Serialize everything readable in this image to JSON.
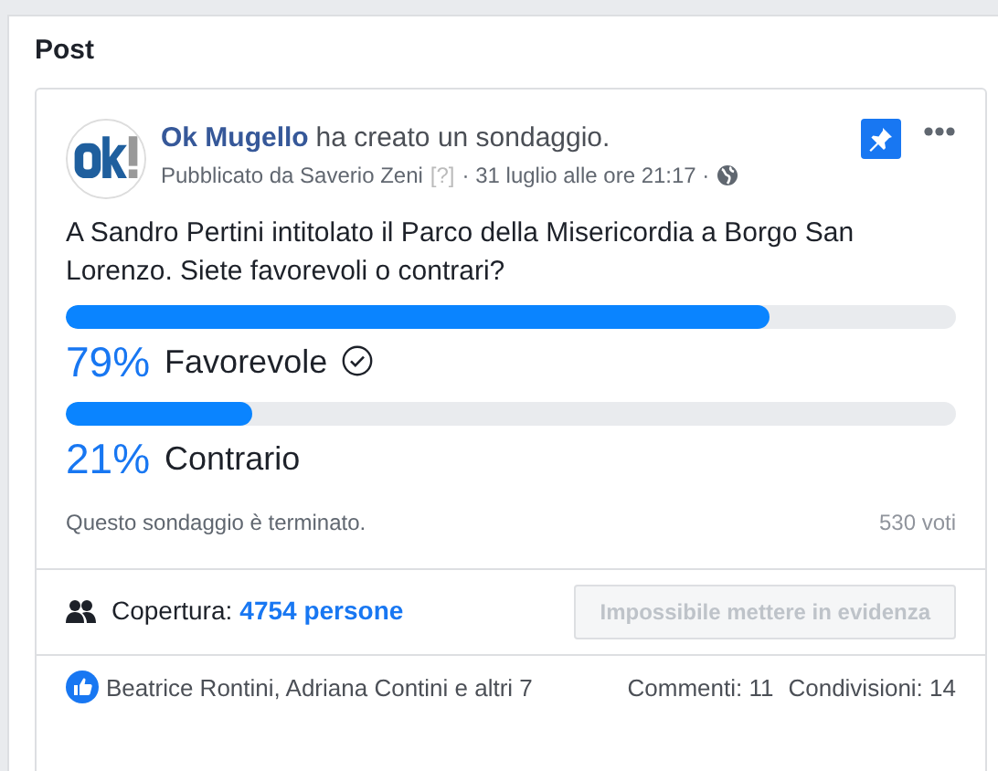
{
  "section_title": "Post",
  "post": {
    "page_name": "Ok Mugello",
    "action": "ha creato un sondaggio.",
    "byline": "Pubblicato da Saverio Zeni",
    "help_mark": "[?]",
    "date": "· 31 luglio alle ore 21:17 ·",
    "pinned": true,
    "text": "A Sandro Pertini intitolato il Parco della Misericordia a Borgo San Lorenzo. Siete favorevoli o contrari?"
  },
  "poll": {
    "options": [
      {
        "percent": "79%",
        "label": "Favorevole",
        "level": 0.79,
        "selected": true
      },
      {
        "percent": "21%",
        "label": "Contrario",
        "level": 0.21,
        "selected": false
      }
    ],
    "status": "Questo sondaggio è terminato.",
    "votes": "530 voti"
  },
  "reach": {
    "label": "Copertura:",
    "value": "4754 persone",
    "boost_button": {
      "label": "Impossibile mettere in evidenza",
      "disabled": true
    }
  },
  "footer": {
    "likes": "Beatrice Rontini, Adriana Contini e altri 7",
    "comments": "Commenti: 11",
    "shares": "Condivisioni: 14"
  }
}
